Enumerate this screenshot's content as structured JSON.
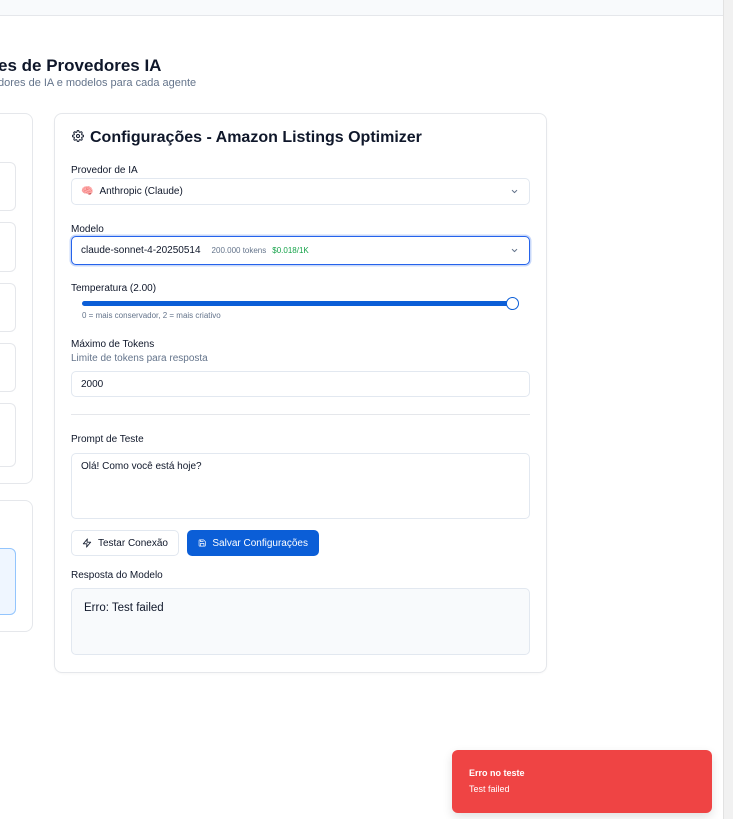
{
  "header": {
    "title": "es de Provedores IA",
    "subtitle": "dores de IA e modelos para cada agente"
  },
  "config": {
    "title": "Configurações - Amazon Listings Optimizer",
    "provider_label": "Provedor de IA",
    "provider_emoji": "🧠",
    "provider_value": "Anthropic (Claude)",
    "model_label": "Modelo",
    "model_value": "claude-sonnet-4-20250514",
    "model_tokens": "200.000 tokens",
    "model_price": "$0.018/1K",
    "temperature_label": "Temperatura (2.00)",
    "temperature_value": 2.0,
    "temperature_max": 2.0,
    "temperature_hint": "0 = mais conservador, 2 = mais criativo",
    "max_tokens_label": "Máximo de Tokens",
    "max_tokens_hint": "Limite de tokens para resposta",
    "max_tokens_value": "2000",
    "prompt_label": "Prompt de Teste",
    "prompt_value": "Olá! Como você está hoje?",
    "test_button": "Testar Conexão",
    "save_button": "Salvar Configurações",
    "response_label": "Resposta do Modelo",
    "response_value": "Erro: Test failed"
  },
  "toast": {
    "title": "Erro no teste",
    "message": "Test failed"
  },
  "colors": {
    "primary": "#0b5ed7",
    "error": "#ef4444",
    "price": "#16a34a"
  }
}
